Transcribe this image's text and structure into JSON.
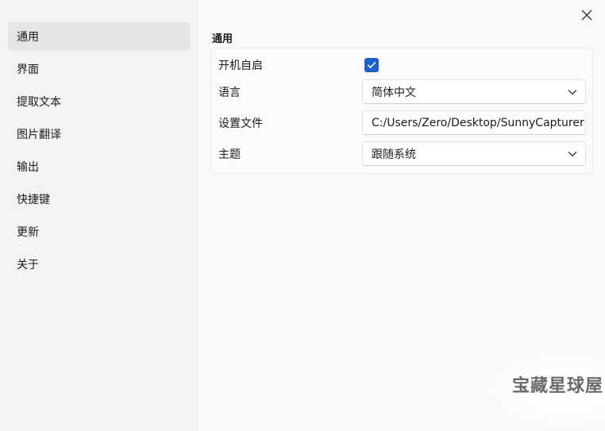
{
  "sidebar": {
    "items": [
      {
        "label": "通用",
        "active": true
      },
      {
        "label": "界面"
      },
      {
        "label": "提取文本"
      },
      {
        "label": "图片翻译"
      },
      {
        "label": "输出"
      },
      {
        "label": "快捷键"
      },
      {
        "label": "更新"
      },
      {
        "label": "关于"
      }
    ]
  },
  "main": {
    "section_title": "通用",
    "settings": {
      "autostart": {
        "label": "开机自启",
        "checked": true
      },
      "language": {
        "label": "语言",
        "value": "简体中文"
      },
      "config_file": {
        "label": "设置文件",
        "value": "C:/Users/Zero/Desktop/SunnyCapturer"
      },
      "theme": {
        "label": "主题",
        "value": "跟随系统"
      }
    }
  },
  "watermark": "宝藏星球屋",
  "colors": {
    "accent": "#1d5fcc",
    "sidebar_bg": "#f3f3f3",
    "active_item_bg": "#e6e6e6",
    "main_bg": "#f9f9f9"
  }
}
